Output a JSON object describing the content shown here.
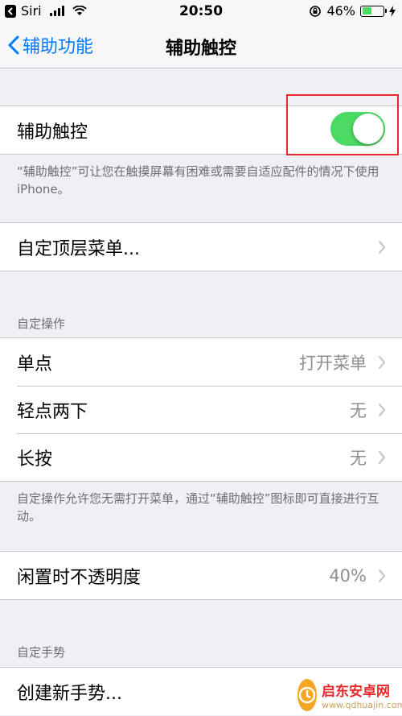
{
  "status_bar": {
    "carrier": "Siri",
    "time": "20:50",
    "battery_percent": "46%",
    "battery_level": 0.46,
    "battery_color": "#4cd964"
  },
  "nav": {
    "back_label": "辅助功能",
    "title": "辅助触控"
  },
  "assistive_touch": {
    "label": "辅助触控",
    "enabled": true,
    "footer": "“辅助触控”可让您在触摸屏幕有困难或需要自适应配件的情况下使用 iPhone。"
  },
  "top_menu": {
    "label": "自定顶层菜单..."
  },
  "custom_actions": {
    "header": "自定操作",
    "rows": [
      {
        "label": "单点",
        "value": "打开菜单"
      },
      {
        "label": "轻点两下",
        "value": "无"
      },
      {
        "label": "长按",
        "value": "无"
      }
    ],
    "footer": "自定操作允许您无需打开菜单，通过“辅助触控”图标即可直接进行互动。"
  },
  "idle_opacity": {
    "label": "闲置时不透明度",
    "value": "40%"
  },
  "custom_gestures": {
    "header": "自定手势",
    "create_label": "创建新手势..."
  },
  "watermark": {
    "title": "启东安卓网",
    "url": "www.qdhuajin.com"
  },
  "colors": {
    "accent": "#007aff",
    "toggle_on": "#4cd964",
    "highlight": "#e8292c"
  }
}
